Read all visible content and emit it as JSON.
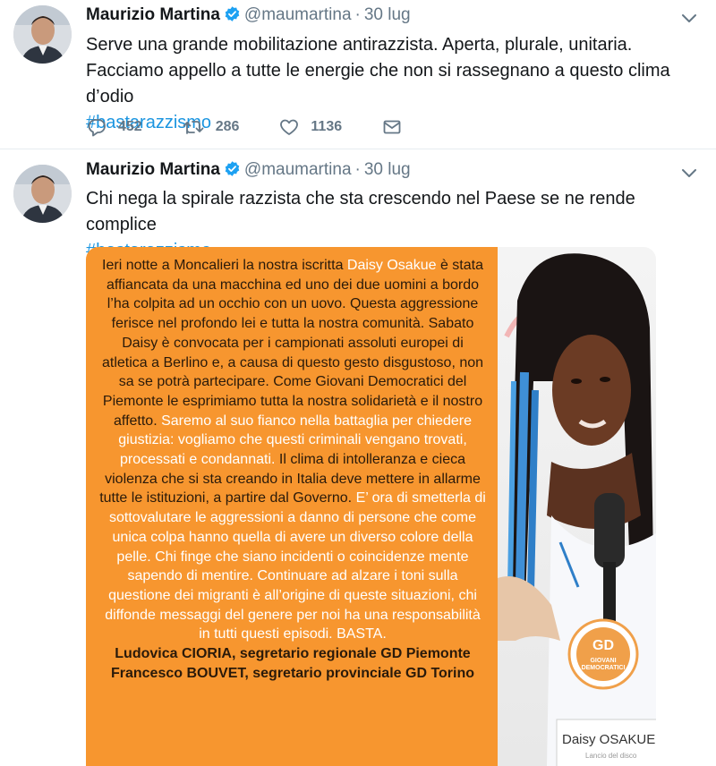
{
  "tweets": [
    {
      "name": "Maurizio Martina",
      "handle": "@maumartina",
      "dot": "·",
      "time": "30 lug",
      "text": "Serve una grande mobilitazione antirazzista. Aperta, plurale, unitaria. Facciamo appello a tutte le energie che non si rassegnano a questo clima d’odio",
      "hashtag": "#bastarazzismo",
      "replies": "452",
      "retweets": "286",
      "likes": "1136"
    },
    {
      "name": "Maurizio Martina",
      "handle": "@maumartina",
      "dot": "·",
      "time": "30 lug",
      "text": "Chi nega la spirale razzista che sta crescendo nel Paese se ne rende complice",
      "hashtag": "#bastarazzismo",
      "media": {
        "p1": "Ieri notte a Moncalieri la nostra iscritta ",
        "p2": "Daisy Osakue",
        "p3": " è stata affiancata da una macchina ed uno dei due uomini a bordo l’ha colpita ad un occhio con un uovo. Questa aggressione ferisce nel profondo lei e tutta la nostra comunità. Sabato Daisy è convocata per i campionati assoluti europei di atletica a Berlino e, a causa di questo gesto disgustoso, non sa se potrà partecipare. Come Giovani Democratici del Piemonte le esprimiamo tutta la nostra solidarietà e il nostro affetto. ",
        "p4": "Saremo al suo fianco nella battaglia per chiedere giustizia: vogliamo che questi criminali vengano trovati, processati e condannati.",
        "p5": " Il clima di intolleranza e cieca violenza che si sta creando in Italia deve mettere in allarme tutte le istituzioni, a partire dal Governo. ",
        "p6": "E’ ora di smetterla di",
        "p7": " sottovalutare le aggressioni a danno di persone che come unica colpa hanno quella di avere un diverso colore della pelle.",
        "p8": " Chi finge che siano incidenti o coincidenze mente sapendo di mentire. Continuare ad alzare i toni sulla questione dei migranti è all’origine di queste situazioni, chi diffonde messaggi del genere per noi ha una responsabilità in tutti questi episodi. BASTA.",
        "sig1": "Ludovica CIORIA, segretario regionale GD Piemonte",
        "sig2": "Francesco BOUVET, segretario provinciale GD Torino",
        "logo_gd": "GD",
        "logo_line1": "GIOVANI",
        "logo_line2": "DEMOCRATICI",
        "card_name": "Daisy OSAKUE",
        "card_sub": "Lancio del disco"
      }
    }
  ],
  "colors": {
    "link": "#1b95e0",
    "verified": "#1da1f2",
    "muted": "#657786",
    "orange": "#f7962f"
  },
  "icons": [
    "verified-icon",
    "caret-down-icon",
    "reply-icon",
    "retweet-icon",
    "like-icon",
    "direct-message-icon"
  ]
}
